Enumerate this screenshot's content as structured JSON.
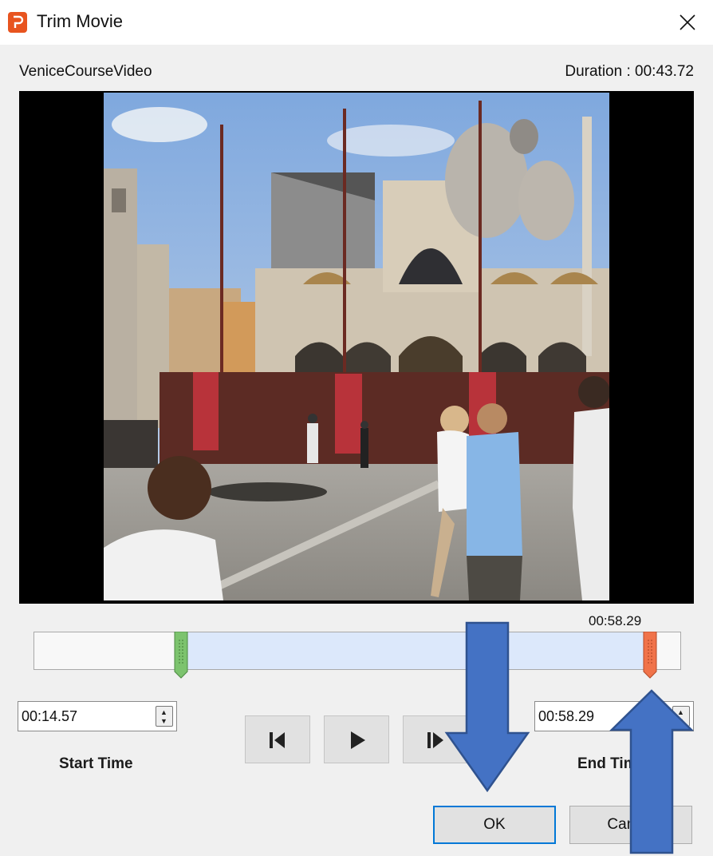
{
  "window": {
    "title": "Trim Movie"
  },
  "video": {
    "file_name": "VeniceCourseVideo",
    "duration": "Duration : 00:43.72"
  },
  "trim": {
    "end_marker_time": "00:58.29"
  },
  "start_time": {
    "value": "00:14.57",
    "label": "Start Time"
  },
  "end_time": {
    "value": "00:58.29",
    "label": "End Time"
  },
  "buttons": {
    "ok": "OK",
    "cancel": "Cancel"
  },
  "icons": {
    "app": "powerpoint-icon",
    "close": "close-icon",
    "previous_frame": "previous-frame-icon",
    "play": "play-icon",
    "next_frame": "next-frame-icon"
  },
  "colors": {
    "selection": "#dce8fb",
    "start_handle": "#7cc36e",
    "end_handle": "#f0734a",
    "annotation_arrow": "#4472c4",
    "default_button_border": "#0078d7"
  }
}
